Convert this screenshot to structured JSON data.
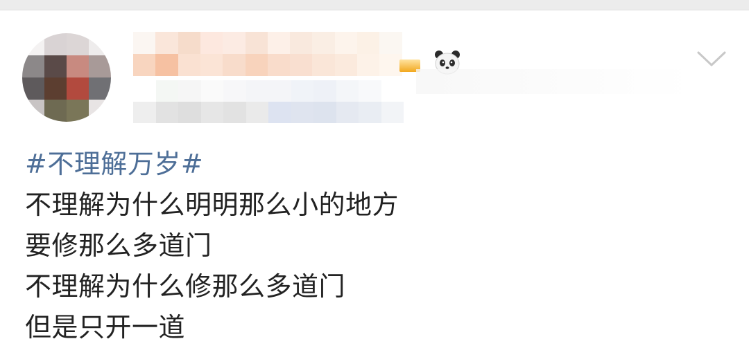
{
  "post": {
    "hashtag": "#不理解万岁#",
    "lines": [
      "不理解为什么明明那么小的地方",
      "要修那么多道门",
      "不理解为什么修那么多道门",
      "但是只开一道"
    ]
  },
  "header": {
    "avatar_icon": "pixelated-avatar",
    "username_state": "pixelated",
    "badge_icon": "panda-icon",
    "menu_icon": "chevron-down-icon"
  },
  "colors": {
    "hashtag": "#4d6e97",
    "text": "#222222",
    "chevron": "#c8c8c8",
    "top_bar": "#ececec"
  }
}
